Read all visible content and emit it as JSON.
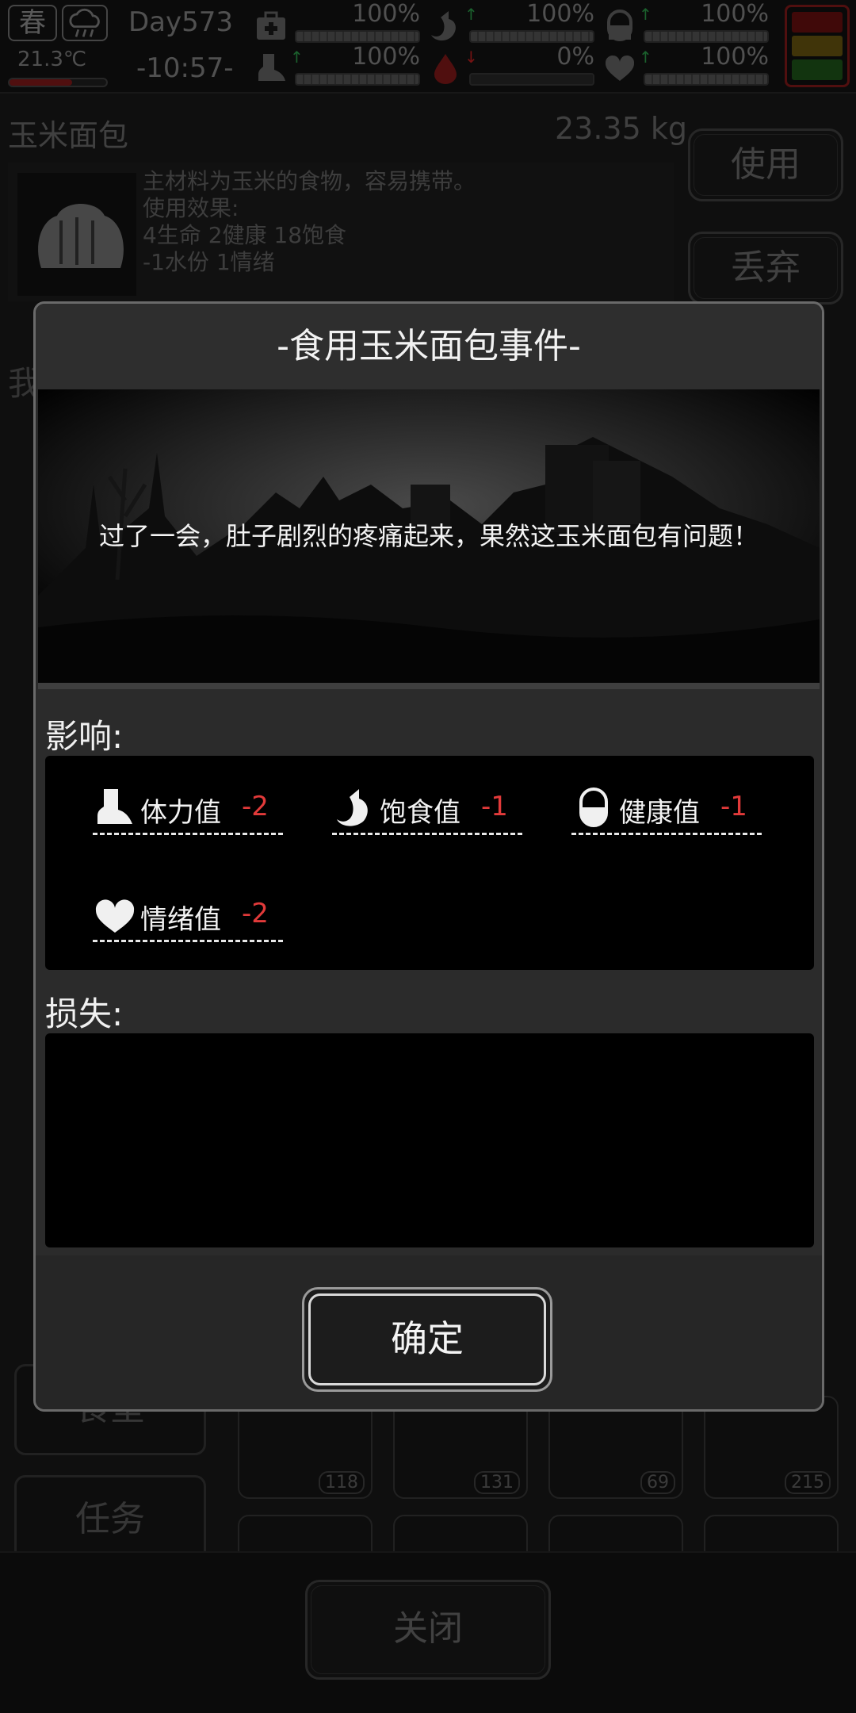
{
  "status": {
    "season": "春",
    "weather_icon": "rain-cloud-icon",
    "temperature": "21.3℃",
    "temperature_level": 0.65,
    "day": "Day573",
    "time": "-10:57-",
    "stats": [
      {
        "name": "medkit",
        "icon": "medkit-icon",
        "percent": "100%",
        "level": 1.0,
        "arrow": ""
      },
      {
        "name": "stomach",
        "icon": "stomach-icon",
        "percent": "100%",
        "level": 1.0,
        "arrow": "↑",
        "arrow_color": "#2fa84f"
      },
      {
        "name": "capsule",
        "icon": "capsule-icon",
        "percent": "100%",
        "level": 1.0,
        "arrow": "↑",
        "arrow_color": "#2fa84f"
      },
      {
        "name": "boot",
        "icon": "boot-icon",
        "percent": "100%",
        "level": 1.0,
        "arrow": "↑",
        "arrow_color": "#2fa84f"
      },
      {
        "name": "water",
        "icon": "water-drop-icon",
        "percent": "0%",
        "level": 0.0,
        "arrow": "↓",
        "arrow_color": "#c22"
      },
      {
        "name": "heart",
        "icon": "heart-icon",
        "percent": "100%",
        "level": 1.0,
        "arrow": "↑",
        "arrow_color": "#2fa84f"
      }
    ]
  },
  "item": {
    "name": "玉米面包",
    "weight": "23.35 kg",
    "desc_lines": [
      "主材料为玉米的食物，容易携带。",
      "使用效果:",
      "4生命 2健康 18饱食",
      "-1水份 1情绪"
    ],
    "use_label": "使用",
    "discard_label": "丢弃"
  },
  "background": {
    "left_peek": "我",
    "side_labels": [
      "食堂",
      "任务"
    ],
    "counts": [
      "118",
      "131",
      "69",
      "215"
    ],
    "close_label": "关闭"
  },
  "modal": {
    "title": "-食用玉米面包事件-",
    "message": "过了一会，肚子剧烈的疼痛起来，果然这玉米面包有问题！",
    "effects_label": "影响:",
    "effects": [
      {
        "icon": "boot-icon",
        "label": "体力值",
        "value": "-2"
      },
      {
        "icon": "stomach-icon",
        "label": "饱食值",
        "value": "-1"
      },
      {
        "icon": "capsule-icon",
        "label": "健康值",
        "value": "-1"
      },
      {
        "icon": "heart-icon",
        "label": "情绪值",
        "value": "-2"
      }
    ],
    "losses_label": "损失:",
    "confirm_label": "确定"
  },
  "colors": {
    "negative": "#e23a3a",
    "positive_arrow": "#2fa84f",
    "warning_red": "#8b1a1a"
  }
}
